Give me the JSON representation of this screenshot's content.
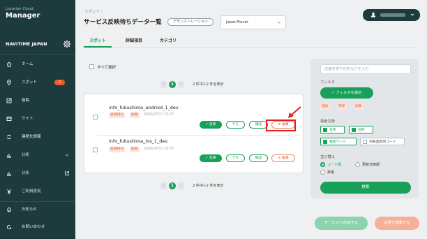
{
  "logo": {
    "small": "Location Cloud",
    "big": "Manager"
  },
  "account": {
    "name": "NAVITIME JAPAN",
    "settings_icon": "gear-icon"
  },
  "sidebar": {
    "items": [
      {
        "label": "ホーム",
        "icon": "home-icon"
      },
      {
        "label": "スポット",
        "icon": "pin-icon",
        "badge": "2"
      },
      {
        "label": "投稿",
        "icon": "edit-icon"
      },
      {
        "label": "サイト",
        "icon": "site-icon"
      },
      {
        "label": "連携先情報",
        "icon": "sync-icon"
      },
      {
        "label": "分析",
        "icon": "chart-icon"
      },
      {
        "label": "分析",
        "icon": "chart-icon"
      },
      {
        "label": "ご利用状況",
        "icon": "yen-icon"
      },
      {
        "label": "お知らせ",
        "icon": "bell-icon"
      },
      {
        "label": "お問い合わせ",
        "icon": "chat-icon"
      }
    ]
  },
  "header": {
    "breadcrumb": "スポット ›",
    "title": "サービス反映待ちデータ一覧",
    "demo_label": "デモンストレーション",
    "env_value": "JapanTravel"
  },
  "tabs": [
    {
      "label": "スポット",
      "active": true
    },
    {
      "label": "詳細項目",
      "active": false
    },
    {
      "label": "カテゴリ",
      "active": false
    }
  ],
  "select_all_label": "すべて選択",
  "pagination": {
    "current": "1",
    "prev": "‹",
    "next": "›",
    "info": "2 件中1-2 件を表示"
  },
  "spots": [
    {
      "name": "info_fukushima_android_1_dev",
      "tags": [
        "反映待ち",
        "削除"
      ],
      "date": "2020/07/17 15:37",
      "buttons": {
        "reflect": "✓ 反映",
        "demo": "デモ",
        "confirm": "確認",
        "discard": "⊘ 破棄"
      }
    },
    {
      "name": "info_fukushima_ios_1_dev",
      "tags": [
        "反映待ち",
        "削除"
      ],
      "date": "2020/07/17 15:37",
      "buttons": {
        "reflect": "✓ 反映",
        "demo": "デモ",
        "confirm": "確認",
        "discard": "⊘ 破棄"
      }
    }
  ],
  "filter_panel": {
    "search_placeholder": "店舗名称や住所などを入力",
    "filter_label": "フィルタ",
    "set_filter_button": "✓ フィルタを設定",
    "chips": [
      "追加",
      "更新",
      "削除"
    ],
    "target_label": "検索対象",
    "targets": [
      {
        "label": "名称",
        "checked": true
      },
      {
        "label": "住所",
        "checked": true
      },
      {
        "label": "検索ワード",
        "checked": true
      },
      {
        "label": "外部連携用コード",
        "checked": false
      }
    ],
    "sort_label": "並び替え",
    "sorts": [
      {
        "label": "コード順",
        "selected": true
      },
      {
        "label": "更新日時順",
        "selected": false
      },
      {
        "label": "昇順",
        "selected": false
      }
    ],
    "search_button": "検索"
  },
  "footer": {
    "apply_button": "サービスへ反映する",
    "discard_button": "変更を破棄する"
  },
  "colors": {
    "brand_green": "#18a058",
    "sidebar_bg": "#1d3a3d",
    "badge_orange": "#f05a28",
    "highlight_red": "#e11d1d"
  }
}
